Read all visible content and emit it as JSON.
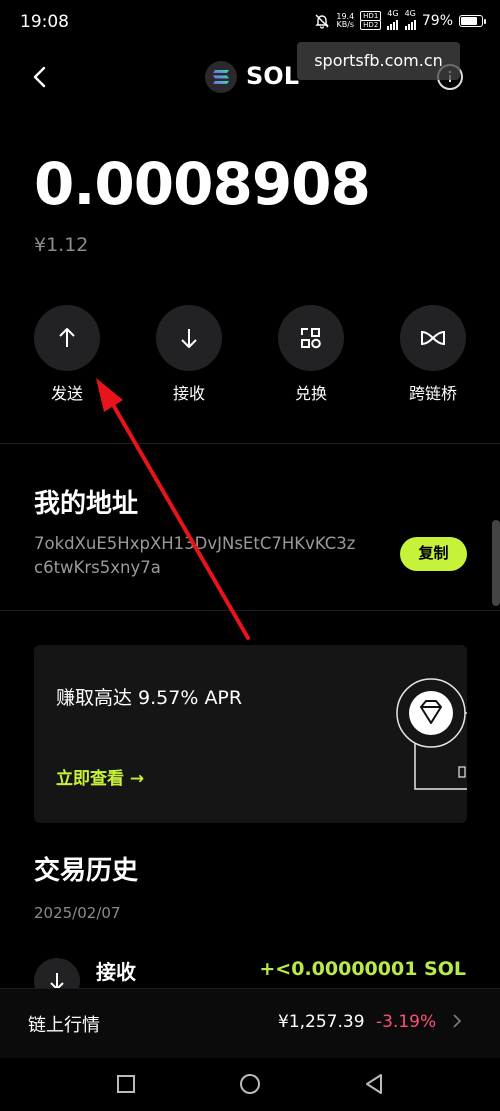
{
  "status_bar": {
    "time": "19:08",
    "net_speed": "19.4",
    "net_unit": "KB/s",
    "hd1": "HD1",
    "hd2": "HD2",
    "sig1": "4G",
    "sig2": "4G",
    "battery": "79%",
    "battery_level": 0.79
  },
  "header": {
    "coin": "SOL",
    "watermark": "sportsfb.com.cn"
  },
  "balance": {
    "amount": "0.0008908",
    "fiat": "¥1.12"
  },
  "actions": [
    {
      "label": "发送",
      "icon": "arrow-up-icon"
    },
    {
      "label": "接收",
      "icon": "arrow-down-icon"
    },
    {
      "label": "兑换",
      "icon": "swap-icon"
    },
    {
      "label": "跨链桥",
      "icon": "bridge-icon"
    }
  ],
  "address_section": {
    "title": "我的地址",
    "address": "7okdXuE5HxpXH13DvJNsEtC7HKvKC3zc6twKrs5xny7a",
    "copy_label": "复制"
  },
  "promo": {
    "title": "赚取高达 9.57% APR",
    "link": "立即查看 →"
  },
  "history": {
    "title": "交易历史",
    "date": "2025/02/07",
    "items": [
      {
        "type": "接收",
        "amount": "+<0.00000001 SOL"
      }
    ]
  },
  "market": {
    "label": "链上行情",
    "price": "¥1,257.39",
    "change": "-3.19%"
  },
  "colors": {
    "accent": "#c6f23a",
    "negative": "#ff4f76",
    "annotation_arrow": "#e8141b"
  }
}
